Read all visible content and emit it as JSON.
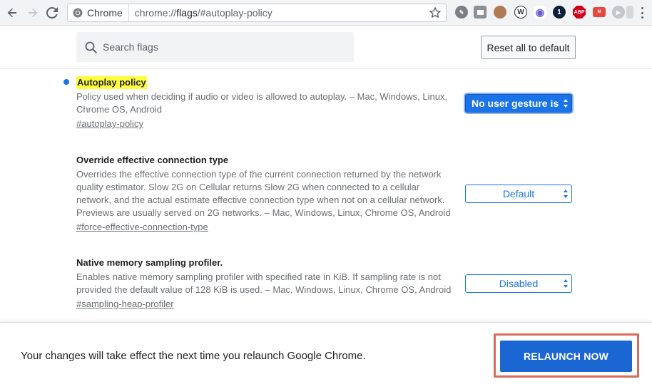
{
  "browser": {
    "site_chip_label": "Chrome",
    "url_prefix": "chrome://",
    "url_host": "flags",
    "url_path": "/#autoplay-policy",
    "icons": [
      "back-arrow-icon",
      "forward-arrow-icon",
      "reload-icon",
      "chrome-logo-icon",
      "bookmark-star-icon",
      "menu-icon"
    ],
    "extensions": [
      {
        "name": "pen-extension",
        "color": "#7a7f85",
        "glyph": "✎"
      },
      {
        "name": "square-extension",
        "color": "#8d9196",
        "glyph": "■"
      },
      {
        "name": "avatar-extension",
        "color": "#b07a55",
        "glyph": ""
      },
      {
        "name": "w-extension",
        "color": "#ffffff",
        "glyph": "W"
      },
      {
        "name": "target-extension",
        "color": "#ffffff",
        "glyph": "◉"
      },
      {
        "name": "onepassword-extension",
        "color": "#0b1f3a",
        "glyph": "1"
      },
      {
        "name": "abp-extension",
        "color": "#d0021b",
        "glyph": "ABP"
      },
      {
        "name": "red-badge-extension",
        "color": "#e8473d",
        "glyph": "M"
      },
      {
        "name": "play-extension",
        "color": "#b9bcc0",
        "glyph": "▶"
      },
      {
        "name": "gray-square-extension",
        "color": "#c7cacd",
        "glyph": "■"
      }
    ]
  },
  "search": {
    "placeholder": "Search flags",
    "reset_label": "Reset all to default"
  },
  "flags": [
    {
      "title": "Autoplay policy",
      "description": "Policy used when deciding if audio or video is allowed to autoplay. – Mac, Windows, Linux, Chrome OS, Android",
      "link": "#autoplay-policy",
      "selected": "No user gesture is required",
      "active": true
    },
    {
      "title": "Override effective connection type",
      "description": "Overrides the effective connection type of the current connection returned by the network quality estimator. Slow 2G on Cellular returns Slow 2G when connected to a cellular network, and the actual estimate effective connection type when not on a cellular network. Previews are usually served on 2G networks. – Mac, Windows, Linux, Chrome OS, Android",
      "link": "#force-effective-connection-type",
      "selected": "Default",
      "active": false
    },
    {
      "title": "Native memory sampling profiler.",
      "description": "Enables native memory sampling profiler with specified rate in KiB. If sampling rate is not provided the default value of 128 KiB is used. – Mac, Windows, Linux, Chrome OS, Android",
      "link": "#sampling-heap-profiler",
      "selected": "Disabled",
      "active": false
    }
  ],
  "relaunch": {
    "message": "Your changes will take effect the next time you relaunch Google Chrome.",
    "button_label": "RELAUNCH NOW"
  },
  "colors": {
    "accent": "#1a73e8",
    "highlight": "#ffff3b",
    "relaunch_button": "#1a66d2",
    "annotation_frame": "#d96b5a"
  }
}
